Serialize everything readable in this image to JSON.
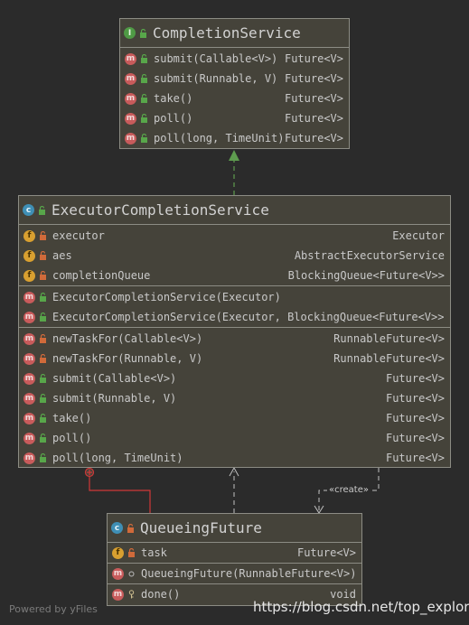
{
  "completion_service": {
    "title": "CompletionService",
    "kind_icon": "interface-icon",
    "methods": [
      {
        "name": "submit(Callable<V>)",
        "type": "Future<V>"
      },
      {
        "name": "submit(Runnable, V)",
        "type": "Future<V>"
      },
      {
        "name": "take()",
        "type": "Future<V>"
      },
      {
        "name": "poll()",
        "type": "Future<V>"
      },
      {
        "name": "poll(long, TimeUnit)",
        "type": "Future<V>"
      }
    ]
  },
  "executor_completion_service": {
    "title": "ExecutorCompletionService",
    "kind_icon": "class-icon",
    "fields": [
      {
        "name": "executor",
        "type": "Executor"
      },
      {
        "name": "aes",
        "type": "AbstractExecutorService"
      },
      {
        "name": "completionQueue",
        "type": "BlockingQueue<Future<V>>"
      }
    ],
    "constructors": [
      {
        "name": "ExecutorCompletionService(Executor)",
        "type": ""
      },
      {
        "name": "ExecutorCompletionService(Executor, BlockingQueue<Future<V>>)",
        "type": ""
      }
    ],
    "methods": [
      {
        "name": "newTaskFor(Callable<V>)",
        "type": "RunnableFuture<V>"
      },
      {
        "name": "newTaskFor(Runnable, V)",
        "type": "RunnableFuture<V>"
      },
      {
        "name": "submit(Callable<V>)",
        "type": "Future<V>"
      },
      {
        "name": "submit(Runnable, V)",
        "type": "Future<V>"
      },
      {
        "name": "take()",
        "type": "Future<V>"
      },
      {
        "name": "poll()",
        "type": "Future<V>"
      },
      {
        "name": "poll(long, TimeUnit)",
        "type": "Future<V>"
      }
    ]
  },
  "queueing_future": {
    "title": "QueueingFuture",
    "kind_icon": "class-icon",
    "fields": [
      {
        "name": "task",
        "type": "Future<V>"
      }
    ],
    "constructors": [
      {
        "name": "QueueingFuture(RunnableFuture<V>)",
        "type": ""
      }
    ],
    "methods": [
      {
        "name": "done()",
        "type": "void"
      }
    ]
  },
  "edges": {
    "create_label": "«create»"
  },
  "footer": {
    "powered_by": "Powered by yFiles",
    "watermark": "https://blog.csdn.net/top_explore"
  },
  "colors": {
    "background": "#2b2b2b",
    "box_fill": "#45433a",
    "box_border": "#8c8c84",
    "method_badge": "#c85b5b",
    "field_badge": "#d9a030",
    "class_badge": "#3f8fb5",
    "interface_badge": "#4f9a45",
    "public_lock": "#58a64a",
    "private_lock": "#d06a3a",
    "inner_class_connector": "#d03838"
  }
}
